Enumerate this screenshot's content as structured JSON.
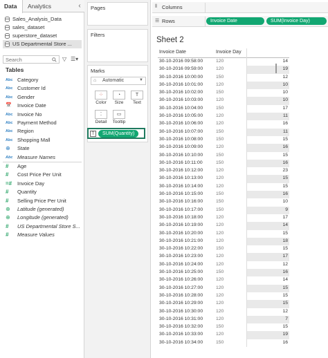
{
  "data_pane": {
    "tabs": [
      "Data",
      "Analytics"
    ],
    "datasources": [
      "Sales_Analysis_Data",
      "sales_dataset",
      "superstore_dataset",
      "US Departmental Store ..."
    ],
    "search_placeholder": "Search",
    "tables_header": "Tables",
    "dimensions": [
      {
        "icon": "Abc",
        "label": "Category"
      },
      {
        "icon": "Abc",
        "label": "Customer Id"
      },
      {
        "icon": "Abc",
        "label": "Gender"
      },
      {
        "icon": "cal",
        "label": "Invoice Date"
      },
      {
        "icon": "Abc",
        "label": "Invoice No"
      },
      {
        "icon": "Abc",
        "label": "Payment Method"
      },
      {
        "icon": "Abc",
        "label": "Region"
      },
      {
        "icon": "Abc",
        "label": "Shopping Mall"
      },
      {
        "icon": "globe",
        "label": "State"
      },
      {
        "icon": "Abc",
        "label": "Measure Names",
        "italic": true
      }
    ],
    "measures": [
      {
        "icon": "#",
        "label": "Age"
      },
      {
        "icon": "#",
        "label": "Cost Price Per Unit"
      },
      {
        "icon": "=#",
        "label": "Invoice Day"
      },
      {
        "icon": "#",
        "label": "Quantity"
      },
      {
        "icon": "#",
        "label": "Selling Price Per Unit"
      },
      {
        "icon": "globe",
        "label": "Latitude (generated)",
        "italic": true
      },
      {
        "icon": "globe",
        "label": "Longitude (generated)",
        "italic": true
      },
      {
        "icon": "#",
        "label": "US Departmental Store S...",
        "italic": true
      },
      {
        "icon": "#",
        "label": "Measure Values",
        "italic": true
      }
    ]
  },
  "cards": {
    "pages_title": "Pages",
    "filters_title": "Filters",
    "marks_title": "Marks",
    "marks_type": "Automatic",
    "mark_buttons": [
      "Color",
      "Size",
      "Text",
      "Detail",
      "Tooltip"
    ],
    "sum_pill": "SUM(Quantity)"
  },
  "shelves": {
    "columns_label": "Columns",
    "rows_label": "Rows",
    "rows_pills": [
      "Invoice Date",
      "SUM(Invoice Day)"
    ]
  },
  "sheet": {
    "title": "Sheet 2",
    "headers": [
      "Invoice Date",
      "Invoice Day"
    ],
    "rows": [
      {
        "date": "30-10-2016 09:58:00",
        "day": "120",
        "value": "14"
      },
      {
        "date": "30-10-2016 09:59:00",
        "day": "120",
        "value": "19"
      },
      {
        "date": "30-10-2016 10:00:00",
        "day": "150",
        "value": "12"
      },
      {
        "date": "30-10-2016 10:01:00",
        "day": "120",
        "value": "10"
      },
      {
        "date": "30-10-2016 10:02:00",
        "day": "150",
        "value": "10"
      },
      {
        "date": "30-10-2016 10:03:00",
        "day": "120",
        "value": "10"
      },
      {
        "date": "30-10-2016 10:04:00",
        "day": "150",
        "value": "17"
      },
      {
        "date": "30-10-2016 10:05:00",
        "day": "120",
        "value": "11"
      },
      {
        "date": "30-10-2016 10:06:00",
        "day": "120",
        "value": "16"
      },
      {
        "date": "30-10-2016 10:07:00",
        "day": "150",
        "value": "11"
      },
      {
        "date": "30-10-2016 10:08:00",
        "day": "150",
        "value": "15"
      },
      {
        "date": "30-10-2016 10:09:00",
        "day": "120",
        "value": "16"
      },
      {
        "date": "30-10-2016 10:10:00",
        "day": "150",
        "value": "15"
      },
      {
        "date": "30-10-2016 10:11:00",
        "day": "150",
        "value": "16"
      },
      {
        "date": "30-10-2016 10:12:00",
        "day": "120",
        "value": "23"
      },
      {
        "date": "30-10-2016 10:13:00",
        "day": "120",
        "value": "15"
      },
      {
        "date": "30-10-2016 10:14:00",
        "day": "120",
        "value": "15"
      },
      {
        "date": "30-10-2016 10:15:00",
        "day": "150",
        "value": "16"
      },
      {
        "date": "30-10-2016 10:16:00",
        "day": "150",
        "value": "10"
      },
      {
        "date": "30-10-2016 10:17:00",
        "day": "150",
        "value": "9"
      },
      {
        "date": "30-10-2016 10:18:00",
        "day": "120",
        "value": "17"
      },
      {
        "date": "30-10-2016 10:19:00",
        "day": "120",
        "value": "14"
      },
      {
        "date": "30-10-2016 10:20:00",
        "day": "120",
        "value": "15"
      },
      {
        "date": "30-10-2016 10:21:00",
        "day": "120",
        "value": "18"
      },
      {
        "date": "30-10-2016 10:22:00",
        "day": "150",
        "value": "15"
      },
      {
        "date": "30-10-2016 10:23:00",
        "day": "120",
        "value": "17"
      },
      {
        "date": "30-10-2016 10:24:00",
        "day": "120",
        "value": "12"
      },
      {
        "date": "30-10-2016 10:25:00",
        "day": "150",
        "value": "16"
      },
      {
        "date": "30-10-2016 10:26:00",
        "day": "120",
        "value": "14"
      },
      {
        "date": "30-10-2016 10:27:00",
        "day": "120",
        "value": "15"
      },
      {
        "date": "30-10-2016 10:28:00",
        "day": "120",
        "value": "15"
      },
      {
        "date": "30-10-2016 10:29:00",
        "day": "120",
        "value": "15"
      },
      {
        "date": "30-10-2016 10:30:00",
        "day": "120",
        "value": "12"
      },
      {
        "date": "30-10-2016 10:31:00",
        "day": "120",
        "value": "7"
      },
      {
        "date": "30-10-2016 10:32:00",
        "day": "150",
        "value": "15"
      },
      {
        "date": "30-10-2016 10:33:00",
        "day": "120",
        "value": "19"
      },
      {
        "date": "30-10-2016 10:34:00",
        "day": "150",
        "value": "16"
      }
    ]
  },
  "colors": {
    "pill_green": "#12a772",
    "selected_border": "#1e7a5e",
    "row_shade": "#e9e9e9"
  }
}
